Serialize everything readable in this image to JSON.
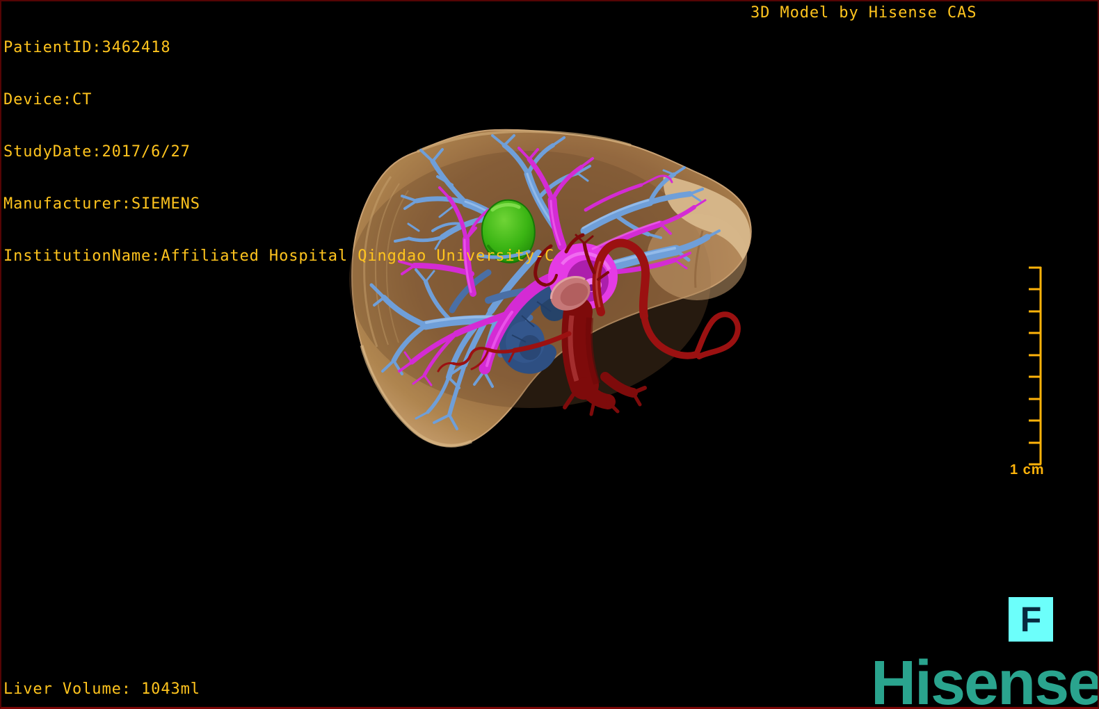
{
  "header_left": {
    "lines": [
      "PatientID:3462418",
      "Device:CT",
      "StudyDate:2017/6/27",
      "Manufacturer:SIEMENS",
      "InstitutionName:Affiliated Hospital Qingdao University-C"
    ]
  },
  "header_right": {
    "text": "3D Model by Hisense CAS"
  },
  "footer": {
    "liver_volume": "Liver Volume: 1043ml"
  },
  "scale_ruler": {
    "label": "1 cm"
  },
  "orientation_marker": {
    "label": "F"
  },
  "brand": {
    "logo_text": "Hisense"
  },
  "colors": {
    "background": "#000000",
    "frame_border": "#550404",
    "overlay_text": "#FFC41E",
    "ruler": "#FFB30A",
    "marker_bg": "#6CFFFB",
    "marker_fg": "#07293E",
    "brand_teal": "#2AA48E",
    "vein_blue": "#6F9FD9",
    "vein_blue_dark": "#4A6FA5",
    "ivc_navy": "#2E4F82",
    "portal_magenta": "#D42BD4",
    "artery_red": "#9B1111",
    "artery_dark": "#7E0B0B"
  }
}
